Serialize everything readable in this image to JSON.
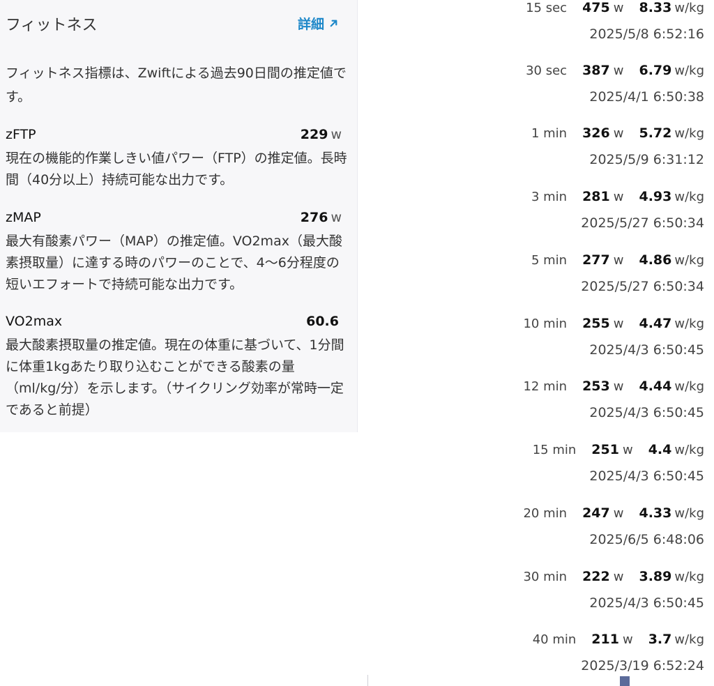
{
  "fitness": {
    "title": "フィットネス",
    "details_label": "詳細",
    "intro": "フィットネス指標は、Zwiftによる過去90日間の推定値です。",
    "metrics": [
      {
        "name": "zFTP",
        "value": "229",
        "unit": "w",
        "description": "現在の機能的作業しきい値パワー（FTP）の推定値。長時間（40分以上）持続可能な出力です。"
      },
      {
        "name": "zMAP",
        "value": "276",
        "unit": "w",
        "description": "最大有酸素パワー（MAP）の推定値。VO2max（最大酸素摂取量）に達する時のパワーのことで、4〜6分程度の短いエフォートで持続可能な出力です。"
      },
      {
        "name": "VO2max",
        "value": "60.6",
        "unit": "",
        "description": "最大酸素摂取量の推定値。現在の体重に基づいて、1分間に体重1kgあたり取り込むことができる酸素の量（ml/kg/分）を示します。（サイクリング効率が常時一定であると前提）"
      }
    ]
  },
  "power_curve": {
    "watts_unit": "w",
    "wkg_unit": "w/kg",
    "rows": [
      {
        "duration": "15 sec",
        "watts": "475",
        "wkg": "8.33",
        "timestamp": "2025/5/8 6:52:16"
      },
      {
        "duration": "30 sec",
        "watts": "387",
        "wkg": "6.79",
        "timestamp": "2025/4/1 6:50:38"
      },
      {
        "duration": "1 min",
        "watts": "326",
        "wkg": "5.72",
        "timestamp": "2025/5/9 6:31:12"
      },
      {
        "duration": "3 min",
        "watts": "281",
        "wkg": "4.93",
        "timestamp": "2025/5/27 6:50:34"
      },
      {
        "duration": "5 min",
        "watts": "277",
        "wkg": "4.86",
        "timestamp": "2025/5/27 6:50:34"
      },
      {
        "duration": "10 min",
        "watts": "255",
        "wkg": "4.47",
        "timestamp": "2025/4/3 6:50:45"
      },
      {
        "duration": "12 min",
        "watts": "253",
        "wkg": "4.44",
        "timestamp": "2025/4/3 6:50:45"
      },
      {
        "duration": "15 min",
        "watts": "251",
        "wkg": "4.4",
        "timestamp": "2025/4/3 6:50:45"
      },
      {
        "duration": "20 min",
        "watts": "247",
        "wkg": "4.33",
        "timestamp": "2025/6/5 6:48:06"
      },
      {
        "duration": "30 min",
        "watts": "222",
        "wkg": "3.89",
        "timestamp": "2025/4/3 6:50:45"
      },
      {
        "duration": "40 min",
        "watts": "211",
        "wkg": "3.7",
        "timestamp": "2025/3/19 6:52:24"
      }
    ]
  },
  "colors": {
    "accent": "#1e88c9",
    "panel_bg": "#f7f7f9",
    "text": "#333333"
  },
  "icons": {
    "details": "arrow-up-right-icon"
  }
}
